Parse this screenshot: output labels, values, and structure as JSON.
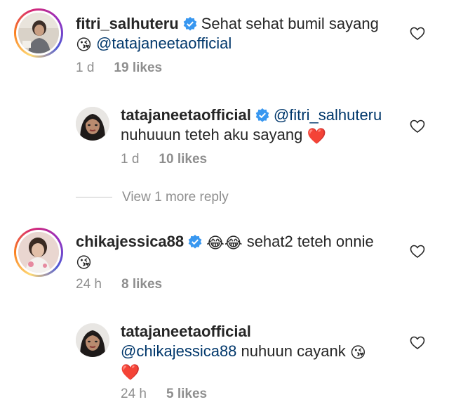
{
  "comments": [
    {
      "username": "fitri_salhuteru",
      "text": "Sehat sehat  bumil sayang",
      "mention": "@tatajaneetaofficial",
      "emoji": "😘",
      "time": "1 d",
      "likes": "19 likes"
    },
    {
      "username": "tatajaneetaofficial",
      "mention": "@fitri_salhuteru",
      "text": "nuhuuun teteh aku sayang",
      "emoji": "❤️",
      "time": "1 d",
      "likes": "10 likes"
    },
    {
      "username": "chikajessica88",
      "emoji_pre": "😂😂",
      "text": "sehat2 teteh onnie",
      "emoji": "😘",
      "time": "24 h",
      "likes": "8 likes"
    },
    {
      "username": "tatajaneetaofficial",
      "mention": "@chikajessica88",
      "text": "nuhuun cayank",
      "emoji": "😘",
      "emoji2": "❤️",
      "time": "24 h",
      "likes": "5 likes"
    }
  ],
  "view_more": "View 1 more reply",
  "icons": {
    "verified": "verified-badge-icon",
    "like": "heart-outline-icon"
  },
  "colors": {
    "verified": "#3897f0",
    "mention": "#00376b",
    "meta": "#8e8e8e",
    "heart": "#ed4956"
  }
}
